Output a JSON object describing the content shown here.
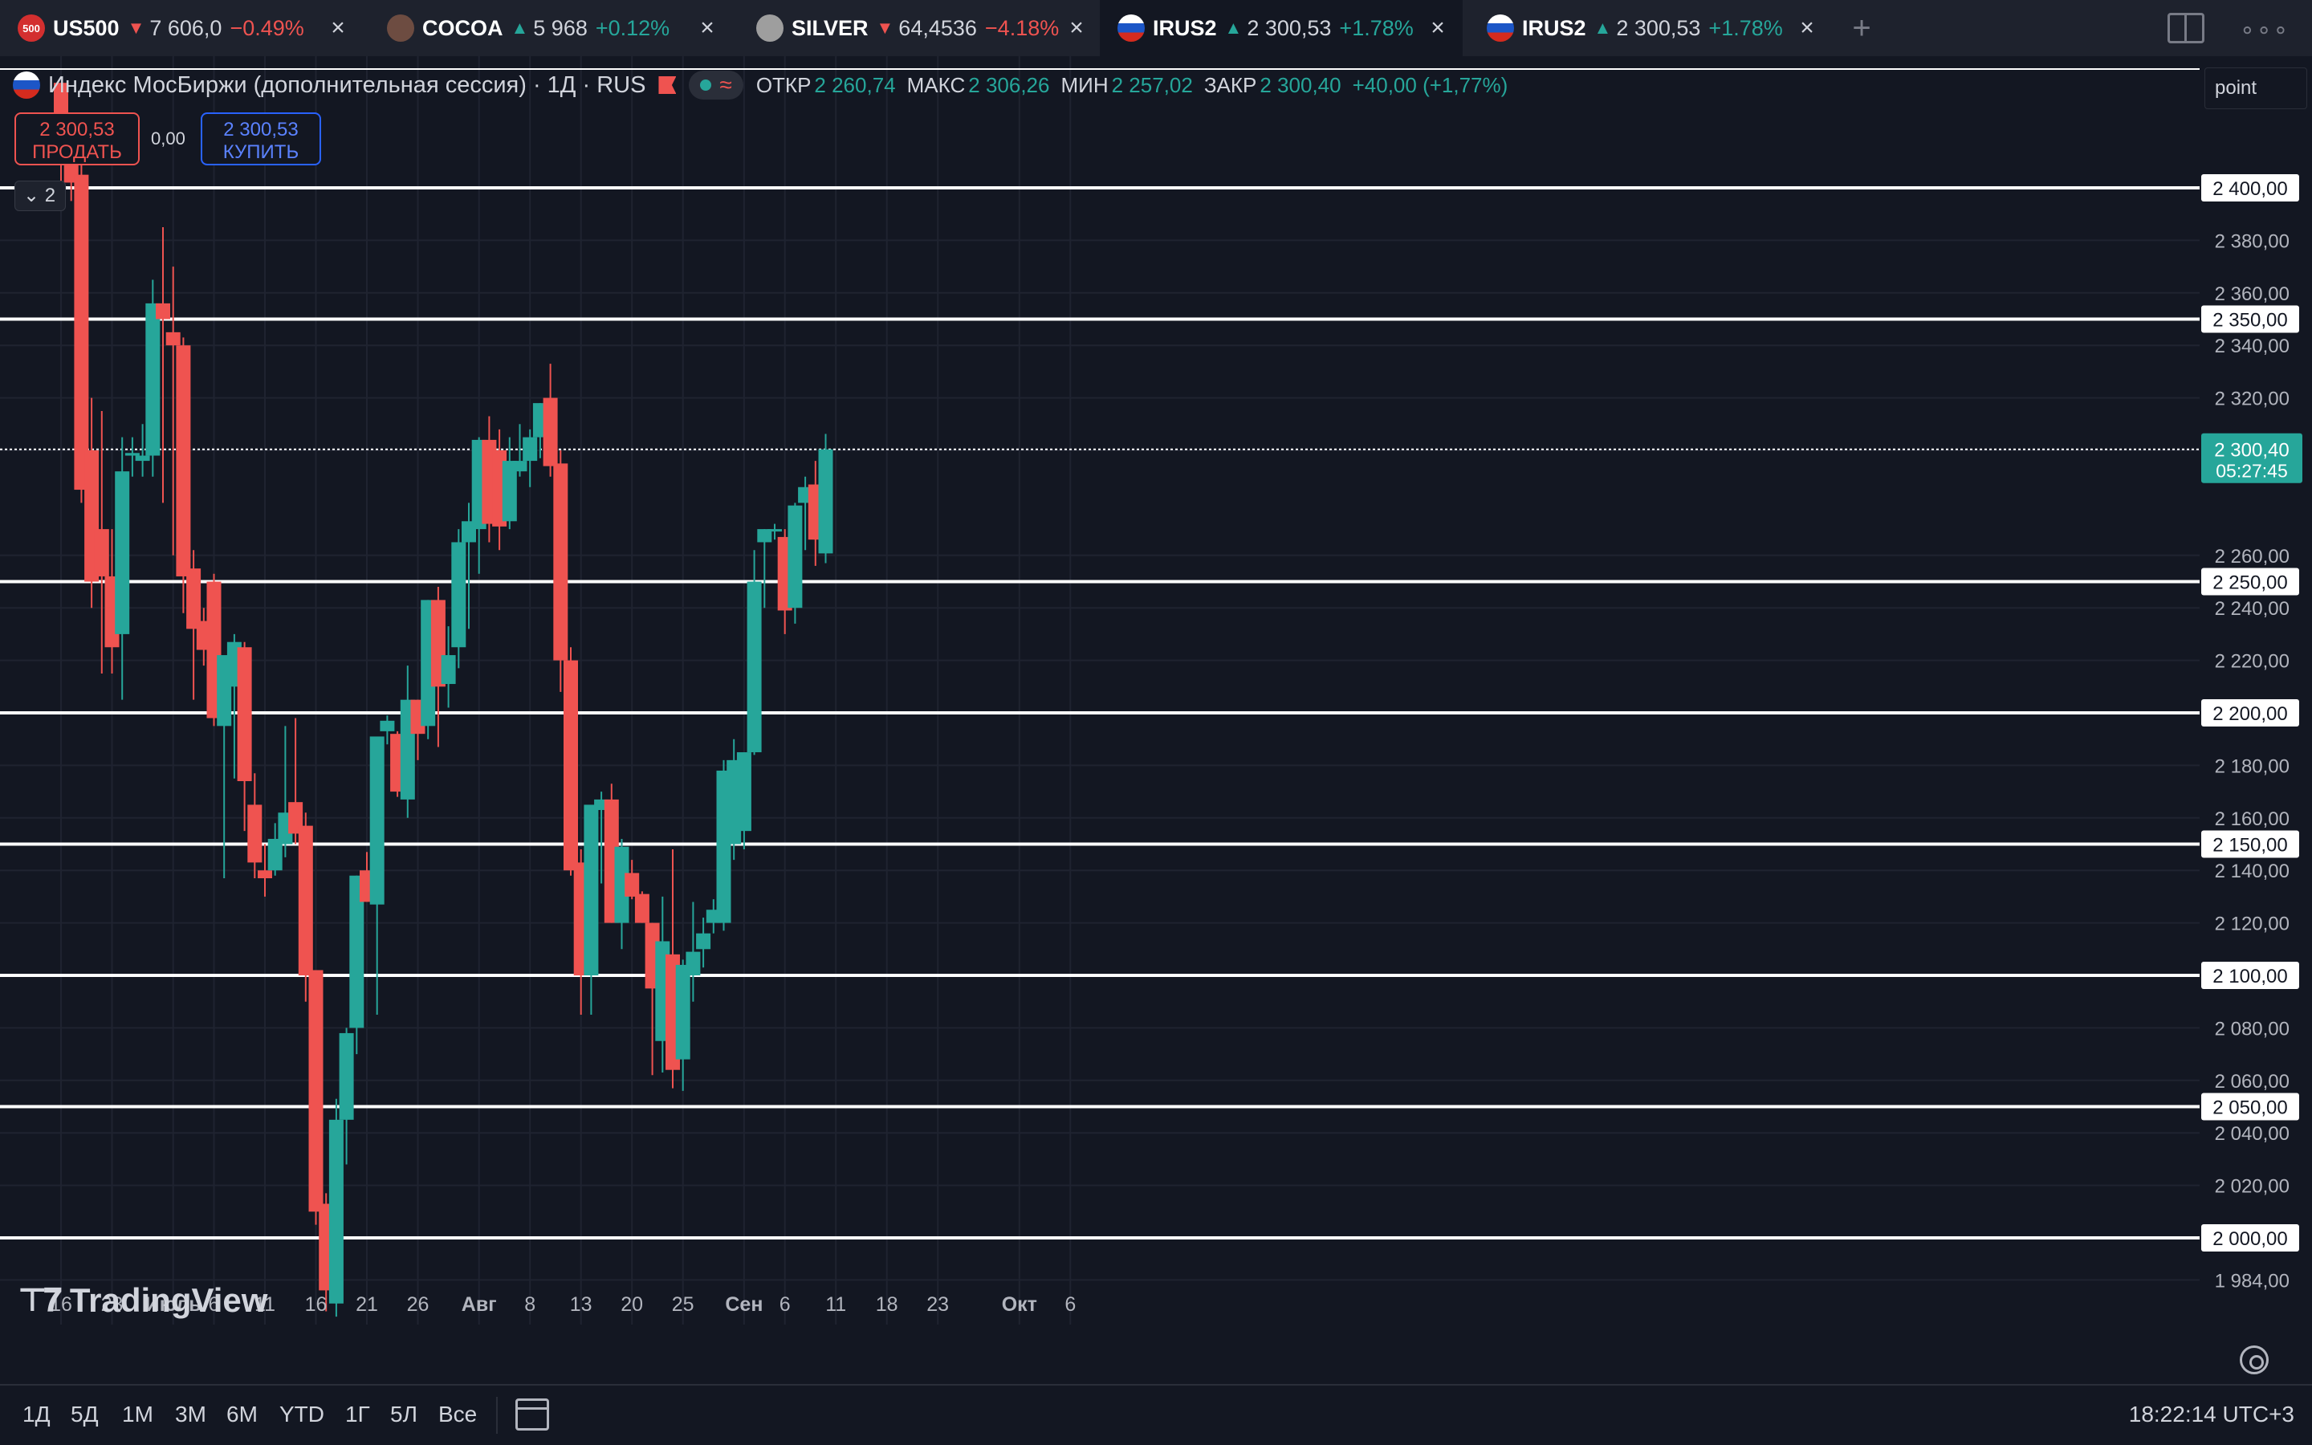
{
  "tabs": [
    {
      "icon": "500",
      "icon_color": "#d32f2f",
      "symbol": "US500",
      "dir": "down",
      "price": "7 606,0",
      "change": "−0.49%",
      "active": false
    },
    {
      "icon": "",
      "icon_color": "#6d4c41",
      "symbol": "COCOA",
      "dir": "up",
      "price": "5 968",
      "change": "+0.12%",
      "active": false
    },
    {
      "icon": "",
      "icon_color": "#9e9e9e",
      "symbol": "SILVER",
      "dir": "down",
      "price": "64,4536",
      "change": "−4.18%",
      "active": false
    },
    {
      "icon": "",
      "icon_color": "ru",
      "symbol": "IRUS2",
      "dir": "up",
      "price": "2 300,53",
      "change": "+1.78%",
      "active": true
    },
    {
      "icon": "",
      "icon_color": "ru",
      "symbol": "IRUS2",
      "dir": "up",
      "price": "2 300,53",
      "change": "+1.78%",
      "active": false
    }
  ],
  "legend": {
    "title": "Индекс МосБиржи (дополнительная сессия) · 1Д · RUS",
    "open_label": "ОТКР",
    "open": "2 260,74",
    "high_label": "МАКС",
    "high": "2 306,26",
    "low_label": "МИН",
    "low": "2 257,02",
    "close_label": "ЗАКР",
    "close": "2 300,40",
    "change": "+40,00 (+1,77%)"
  },
  "trade": {
    "sell_price": "2 300,53",
    "sell_label": "ПРОДАТЬ",
    "spread": "0,00",
    "buy_price": "2 300,53",
    "buy_label": "КУПИТЬ"
  },
  "indicators_count": "2",
  "search": {
    "value": "point"
  },
  "watermark": "TradingView",
  "colors": {
    "up": "#26a69a",
    "down": "#ef5350",
    "bg": "#131722",
    "grid": "#1f2330",
    "level": "#ffffff"
  },
  "chart_data": {
    "type": "candlestick",
    "ylim": [
      1970,
      2420
    ],
    "y_ticks": [
      "2 400,00",
      "2 380,00",
      "2 360,00",
      "2 340,00",
      "2 320,00",
      "2 300,00",
      "2 260,00",
      "2 240,00",
      "2 220,00",
      "2 200,00",
      "2 180,00",
      "2 160,00",
      "2 140,00",
      "2 120,00",
      "2 100,00",
      "2 080,00",
      "2 060,00",
      "2 040,00",
      "2 020,00",
      "2 000,00",
      "1 984,00"
    ],
    "y_tick_values": [
      2400,
      2380,
      2360,
      2340,
      2320,
      2300,
      2260,
      2240,
      2220,
      2200,
      2180,
      2160,
      2140,
      2120,
      2100,
      2080,
      2060,
      2040,
      2020,
      2000,
      1984
    ],
    "horizontal_levels": [
      {
        "value": 2400,
        "label": "2 400,00"
      },
      {
        "value": 2350,
        "label": "2 350,00"
      },
      {
        "value": 2250,
        "label": "2 250,00"
      },
      {
        "value": 2200,
        "label": "2 200,00"
      },
      {
        "value": 2150,
        "label": "2 150,00"
      },
      {
        "value": 2100,
        "label": "2 100,00"
      },
      {
        "value": 2050,
        "label": "2 050,00"
      },
      {
        "value": 2000,
        "label": "2 000,00"
      }
    ],
    "last_price": {
      "value": 2300.4,
      "label": "2 300,40",
      "countdown": "05:27:45"
    },
    "x_labels": [
      {
        "label": "16",
        "index": 0
      },
      {
        "label": "23",
        "index": 5
      },
      {
        "label": "Июль",
        "index": 11
      },
      {
        "label": "6",
        "index": 15
      },
      {
        "label": "11",
        "index": 20
      },
      {
        "label": "16",
        "index": 25
      },
      {
        "label": "21",
        "index": 30
      },
      {
        "label": "26",
        "index": 35
      },
      {
        "label": "Авг",
        "index": 41
      },
      {
        "label": "8",
        "index": 46
      },
      {
        "label": "13",
        "index": 51
      },
      {
        "label": "20",
        "index": 56
      },
      {
        "label": "25",
        "index": 61
      },
      {
        "label": "Сен",
        "index": 67
      },
      {
        "label": "6",
        "index": 71
      },
      {
        "label": "11",
        "index": 76
      },
      {
        "label": "18",
        "index": 81
      },
      {
        "label": "23",
        "index": 86
      },
      {
        "label": "Окт",
        "index": 94
      },
      {
        "label": "6",
        "index": 99
      }
    ],
    "candles": [
      [
        2440,
        2440,
        2400,
        2412
      ],
      [
        2412,
        2418,
        2395,
        2402
      ],
      [
        2405,
        2410,
        2280,
        2285
      ],
      [
        2300,
        2320,
        2240,
        2250
      ],
      [
        2270,
        2315,
        2215,
        2252
      ],
      [
        2252,
        2270,
        2215,
        2225
      ],
      [
        2230,
        2305,
        2205,
        2292
      ],
      [
        2298,
        2305,
        2290,
        2299
      ],
      [
        2296,
        2310,
        2290,
        2298
      ],
      [
        2298,
        2365,
        2290,
        2356
      ],
      [
        2356,
        2385,
        2280,
        2350
      ],
      [
        2345,
        2370,
        2260,
        2340
      ],
      [
        2340,
        2343,
        2238,
        2252
      ],
      [
        2255,
        2262,
        2205,
        2232
      ],
      [
        2235,
        2240,
        2218,
        2224
      ],
      [
        2250,
        2253,
        2195,
        2198
      ],
      [
        2195,
        2217,
        2137,
        2222
      ],
      [
        2210,
        2230,
        2175,
        2227
      ],
      [
        2225,
        2227,
        2155,
        2174
      ],
      [
        2165,
        2177,
        2137,
        2143
      ],
      [
        2140,
        2150,
        2130,
        2137
      ],
      [
        2140,
        2158,
        2138,
        2152
      ],
      [
        2150,
        2195,
        2145,
        2162
      ],
      [
        2166,
        2198,
        2150,
        2154
      ],
      [
        2157,
        2162,
        2090,
        2100
      ],
      [
        2102,
        2102,
        2005,
        2010
      ],
      [
        2013,
        2017,
        1972,
        1980
      ],
      [
        1975,
        2053,
        1970,
        2045
      ],
      [
        2045,
        2080,
        2028,
        2078
      ],
      [
        2080,
        2138,
        2070,
        2138
      ],
      [
        2140,
        2147,
        2128,
        2128
      ],
      [
        2127,
        2188,
        2085,
        2191
      ],
      [
        2193,
        2199,
        2188,
        2197
      ],
      [
        2192,
        2193,
        2168,
        2170
      ],
      [
        2167,
        2218,
        2160,
        2205
      ],
      [
        2205,
        2205,
        2182,
        2192
      ],
      [
        2195,
        2243,
        2190,
        2243
      ],
      [
        2243,
        2248,
        2187,
        2210
      ],
      [
        2211,
        2233,
        2202,
        2222
      ],
      [
        2225,
        2270,
        2217,
        2265
      ],
      [
        2265,
        2280,
        2232,
        2273
      ],
      [
        2270,
        2305,
        2253,
        2304
      ],
      [
        2304,
        2313,
        2265,
        2272
      ],
      [
        2300,
        2308,
        2262,
        2271
      ],
      [
        2273,
        2305,
        2270,
        2296
      ],
      [
        2292,
        2310,
        2290,
        2296
      ],
      [
        2296,
        2308,
        2286,
        2305
      ],
      [
        2305,
        2318,
        2297,
        2318
      ],
      [
        2320,
        2333,
        2290,
        2294
      ],
      [
        2295,
        2300,
        2208,
        2220
      ],
      [
        2220,
        2225,
        2138,
        2140
      ],
      [
        2143,
        2148,
        2085,
        2100
      ],
      [
        2100,
        2165,
        2085,
        2165
      ],
      [
        2163,
        2170,
        2135,
        2167
      ],
      [
        2167,
        2173,
        2120,
        2120
      ],
      [
        2120,
        2152,
        2110,
        2149
      ],
      [
        2139,
        2144,
        2129,
        2130
      ],
      [
        2131,
        2132,
        2120,
        2120
      ],
      [
        2120,
        2120,
        2062,
        2095
      ],
      [
        2075,
        2130,
        2063,
        2113
      ],
      [
        2108,
        2148,
        2057,
        2064
      ],
      [
        2068,
        2106,
        2056,
        2104
      ],
      [
        2100,
        2128,
        2090,
        2109
      ],
      [
        2110,
        2122,
        2103,
        2116
      ],
      [
        2120,
        2129,
        2116,
        2125
      ],
      [
        2120,
        2182,
        2117,
        2178
      ],
      [
        2150,
        2190,
        2144,
        2182
      ],
      [
        2155,
        2182,
        2148,
        2185
      ],
      [
        2185,
        2262,
        2184,
        2250
      ],
      [
        2265,
        2270,
        2240,
        2270
      ],
      [
        2270,
        2272,
        2266,
        2270
      ],
      [
        2267,
        2270,
        2230,
        2239
      ],
      [
        2240,
        2280,
        2234,
        2279
      ],
      [
        2280,
        2290,
        2262,
        2286
      ],
      [
        2287,
        2296,
        2256,
        2266
      ],
      [
        2260.74,
        2306.26,
        2257.02,
        2300.4
      ]
    ]
  },
  "bottom": {
    "ranges": [
      "1Д",
      "5Д",
      "1М",
      "3М",
      "6М",
      "YTD",
      "1Г",
      "5Л",
      "Все"
    ],
    "clock": "18:22:14 UTC+3"
  }
}
